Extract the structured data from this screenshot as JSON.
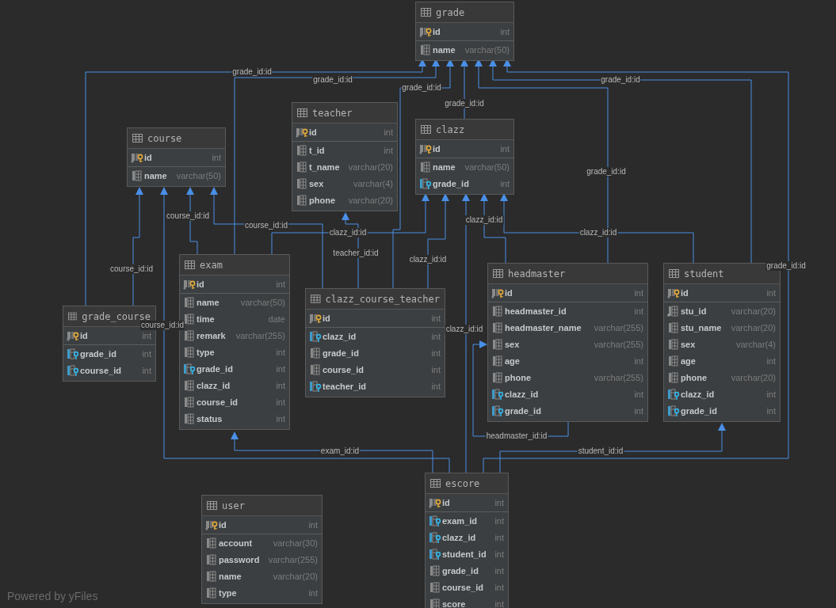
{
  "tables": [
    {
      "name": "grade",
      "columns": [
        {
          "name": "id",
          "type": "int",
          "kind": "pk"
        },
        {
          "name": "name",
          "type": "varchar(50)",
          "kind": "plain"
        }
      ]
    },
    {
      "name": "course",
      "columns": [
        {
          "name": "id",
          "type": "int",
          "kind": "pk"
        },
        {
          "name": "name",
          "type": "varchar(50)",
          "kind": "plain"
        }
      ]
    },
    {
      "name": "teacher",
      "columns": [
        {
          "name": "id",
          "type": "int",
          "kind": "pk"
        },
        {
          "name": "t_id",
          "type": "int",
          "kind": "plain"
        },
        {
          "name": "t_name",
          "type": "varchar(20)",
          "kind": "plain"
        },
        {
          "name": "sex",
          "type": "varchar(4)",
          "kind": "plain"
        },
        {
          "name": "phone",
          "type": "varchar(20)",
          "kind": "plain"
        }
      ]
    },
    {
      "name": "clazz",
      "columns": [
        {
          "name": "id",
          "type": "int",
          "kind": "pk"
        },
        {
          "name": "name",
          "type": "varchar(50)",
          "kind": "plain"
        },
        {
          "name": "grade_id",
          "type": "int",
          "kind": "fk"
        }
      ]
    },
    {
      "name": "grade_course",
      "columns": [
        {
          "name": "id",
          "type": "int",
          "kind": "pk"
        },
        {
          "name": "grade_id",
          "type": "int",
          "kind": "fk"
        },
        {
          "name": "course_id",
          "type": "int",
          "kind": "fk"
        }
      ]
    },
    {
      "name": "exam",
      "columns": [
        {
          "name": "id",
          "type": "int",
          "kind": "pk"
        },
        {
          "name": "name",
          "type": "varchar(50)",
          "kind": "plain"
        },
        {
          "name": "time",
          "type": "date",
          "kind": "plain"
        },
        {
          "name": "remark",
          "type": "varchar(255)",
          "kind": "plain"
        },
        {
          "name": "type",
          "type": "int",
          "kind": "plain"
        },
        {
          "name": "grade_id",
          "type": "int",
          "kind": "fk"
        },
        {
          "name": "clazz_id",
          "type": "int",
          "kind": "plain"
        },
        {
          "name": "course_id",
          "type": "int",
          "kind": "plain"
        },
        {
          "name": "status",
          "type": "int",
          "kind": "plain"
        }
      ]
    },
    {
      "name": "clazz_course_teacher",
      "columns": [
        {
          "name": "id",
          "type": "int",
          "kind": "pk"
        },
        {
          "name": "clazz_id",
          "type": "int",
          "kind": "fk"
        },
        {
          "name": "grade_id",
          "type": "int",
          "kind": "plain"
        },
        {
          "name": "course_id",
          "type": "int",
          "kind": "plain"
        },
        {
          "name": "teacher_id",
          "type": "int",
          "kind": "fk"
        }
      ]
    },
    {
      "name": "headmaster",
      "columns": [
        {
          "name": "id",
          "type": "int",
          "kind": "pk"
        },
        {
          "name": "headmaster_id",
          "type": "int",
          "kind": "plain"
        },
        {
          "name": "headmaster_name",
          "type": "varchar(255)",
          "kind": "plain"
        },
        {
          "name": "sex",
          "type": "varchar(255)",
          "kind": "plain"
        },
        {
          "name": "age",
          "type": "int",
          "kind": "plain"
        },
        {
          "name": "phone",
          "type": "varchar(255)",
          "kind": "plain"
        },
        {
          "name": "clazz_id",
          "type": "int",
          "kind": "fk"
        },
        {
          "name": "grade_id",
          "type": "int",
          "kind": "fk"
        }
      ]
    },
    {
      "name": "student",
      "columns": [
        {
          "name": "id",
          "type": "int",
          "kind": "pk"
        },
        {
          "name": "stu_id",
          "type": "varchar(20)",
          "kind": "index"
        },
        {
          "name": "stu_name",
          "type": "varchar(20)",
          "kind": "plain"
        },
        {
          "name": "sex",
          "type": "varchar(4)",
          "kind": "plain"
        },
        {
          "name": "age",
          "type": "int",
          "kind": "plain"
        },
        {
          "name": "phone",
          "type": "varchar(20)",
          "kind": "plain"
        },
        {
          "name": "clazz_id",
          "type": "int",
          "kind": "fk"
        },
        {
          "name": "grade_id",
          "type": "int",
          "kind": "fk"
        }
      ]
    },
    {
      "name": "user",
      "columns": [
        {
          "name": "id",
          "type": "int",
          "kind": "pk"
        },
        {
          "name": "account",
          "type": "varchar(30)",
          "kind": "plain"
        },
        {
          "name": "password",
          "type": "varchar(255)",
          "kind": "plain"
        },
        {
          "name": "name",
          "type": "varchar(20)",
          "kind": "plain"
        },
        {
          "name": "type",
          "type": "int",
          "kind": "plain"
        }
      ]
    },
    {
      "name": "escore",
      "columns": [
        {
          "name": "id",
          "type": "int",
          "kind": "pk"
        },
        {
          "name": "exam_id",
          "type": "int",
          "kind": "fk"
        },
        {
          "name": "clazz_id",
          "type": "int",
          "kind": "fk"
        },
        {
          "name": "student_id",
          "type": "int",
          "kind": "fk"
        },
        {
          "name": "grade_id",
          "type": "int",
          "kind": "plain"
        },
        {
          "name": "course_id",
          "type": "int",
          "kind": "plain"
        },
        {
          "name": "score",
          "type": "int",
          "kind": "plain"
        }
      ]
    }
  ],
  "relations": [
    {
      "label": "grade_id:id"
    },
    {
      "label": "grade_id:id"
    },
    {
      "label": "grade_id:id"
    },
    {
      "label": "grade_id:id"
    },
    {
      "label": "grade_id:id"
    },
    {
      "label": "grade_id:id"
    },
    {
      "label": "course_id:id"
    },
    {
      "label": "clazz_id:id"
    },
    {
      "label": "course_id:id"
    },
    {
      "label": "clazz_id:id"
    },
    {
      "label": "clazz_id:id"
    },
    {
      "label": "teacher_id:id"
    },
    {
      "label": "clazz_id:id"
    },
    {
      "label": "grade_id:id"
    },
    {
      "label": "course_id:id"
    },
    {
      "label": "course_id:id"
    },
    {
      "label": "clazz_id:id"
    },
    {
      "label": "headmaster_id:id"
    },
    {
      "label": "exam_id:id"
    },
    {
      "label": "student_id:id"
    }
  ],
  "footer": "Powered by yFiles"
}
